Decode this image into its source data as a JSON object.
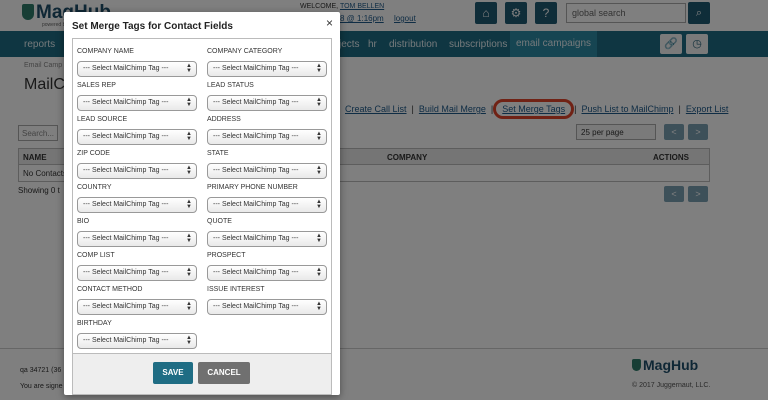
{
  "header": {
    "logo_text": "MagHub",
    "logo_sub": "powered by juggernaut",
    "welcome_label": "WELCOME,",
    "user_name": "TOM BELLEN",
    "datetime": "8 @ 1:16pm",
    "logout": "logout",
    "search_placeholder": "global search"
  },
  "nav": {
    "items": [
      "reports",
      "jects",
      "hr",
      "distribution",
      "subscriptions",
      "email campaigns"
    ]
  },
  "page": {
    "breadcrumb": "Email Camp",
    "title": "MailCh",
    "links": {
      "create_call_list": "Create Call List",
      "build_mail_merge": "Build Mail Merge",
      "set_merge_tags": "Set Merge Tags",
      "push_list": "Push List to MailChimp",
      "export_list": "Export List"
    },
    "search_placeholder": "Search...",
    "per_page": "25 per page",
    "prev": "<",
    "next": ">",
    "table": {
      "headers": [
        "NAME",
        "COMPANY",
        "ACTIONS"
      ],
      "empty": "No Contacts"
    },
    "showing": "Showing 0 t"
  },
  "footer": {
    "left_line1": "qa 34721 (36",
    "left_line2": "You are signe",
    "logo_text": "MagHub",
    "copyright": "© 2017 Juggernaut, LLC."
  },
  "modal": {
    "title": "Set Merge Tags for Contact Fields",
    "close": "×",
    "select_placeholder": "--- Select MailChimp Tag ---",
    "fields": [
      {
        "label": "COMPANY NAME",
        "value": "--- Select MailChimp Tag ---"
      },
      {
        "label": "COMPANY CATEGORY",
        "value": "--- Select MailChimp Tag ---"
      },
      {
        "label": "SALES REP",
        "value": "--- Select MailChimp Tag ---"
      },
      {
        "label": "LEAD STATUS",
        "value": "--- Select MailChimp Tag ---"
      },
      {
        "label": "LEAD SOURCE",
        "value": "--- Select MailChimp Tag ---"
      },
      {
        "label": "ADDRESS",
        "value": "--- Select MailChimp Tag ---"
      },
      {
        "label": "ZIP CODE",
        "value": "--- Select MailChimp Tag ---"
      },
      {
        "label": "STATE",
        "value": "--- Select MailChimp Tag ---"
      },
      {
        "label": "COUNTRY",
        "value": "--- Select MailChimp Tag ---"
      },
      {
        "label": "PRIMARY PHONE NUMBER",
        "value": "--- Select MailChimp Tag ---"
      },
      {
        "label": "BIO",
        "value": "--- Select MailChimp Tag ---"
      },
      {
        "label": "QUOTE",
        "value": "--- Select MailChimp Tag ---"
      },
      {
        "label": "COMP LIST",
        "value": "--- Select MailChimp Tag ---"
      },
      {
        "label": "PROSPECT",
        "value": "--- Select MailChimp Tag ---"
      },
      {
        "label": "CONTACT METHOD",
        "value": "--- Select MailChimp Tag ---"
      },
      {
        "label": "ISSUE INTEREST",
        "value": "--- Select MailChimp Tag ---"
      },
      {
        "label": "BIRTHDAY",
        "value": "--- Select MailChimp Tag ---"
      }
    ],
    "save_label": "SAVE",
    "cancel_label": "CANCEL"
  },
  "colors": {
    "nav_bg": "#1f6d84",
    "primary_button": "#1f6d84",
    "cancel_button": "#707070",
    "highlight_ring": "#e0452a"
  }
}
